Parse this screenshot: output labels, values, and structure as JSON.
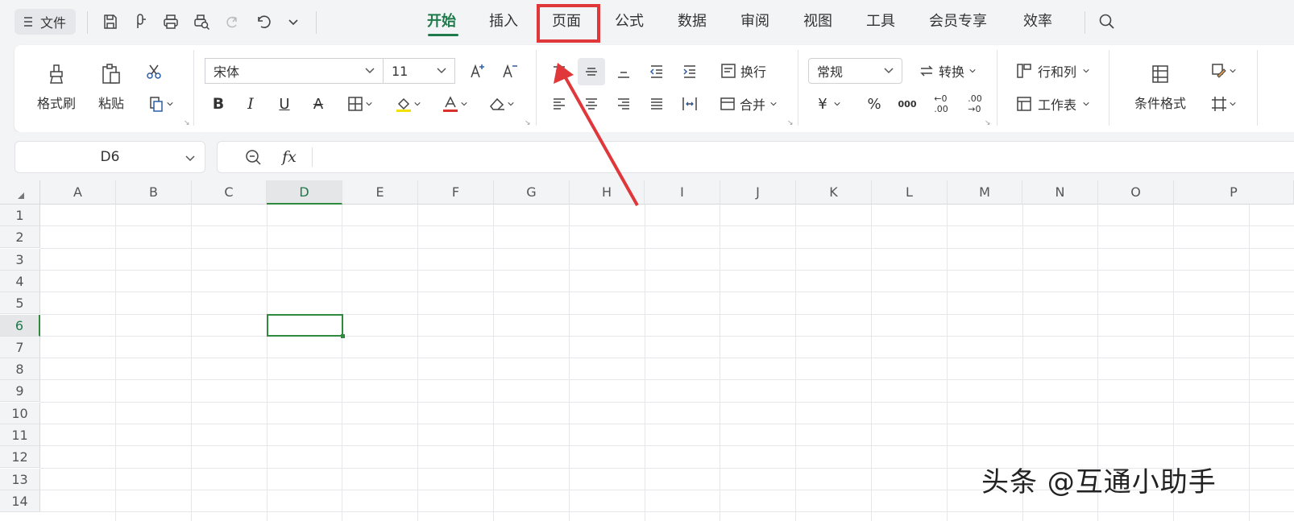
{
  "toolbar": {
    "file_label": "文件",
    "tabs": [
      "开始",
      "插入",
      "页面",
      "公式",
      "数据",
      "审阅",
      "视图",
      "工具",
      "会员专享",
      "效率"
    ],
    "active_tab": "开始",
    "highlighted_tab": "页面"
  },
  "ribbon": {
    "format_painter": "格式刷",
    "paste": "粘贴",
    "font_name": "宋体",
    "font_size": "11",
    "wrap": "换行",
    "merge": "合并",
    "number_format": "常规",
    "convert": "转换",
    "rows_cols": "行和列",
    "worksheet": "工作表",
    "conditional_format": "条件格式"
  },
  "formula_bar": {
    "cell_ref": "D6",
    "fx": "fx"
  },
  "sheet": {
    "columns": [
      "A",
      "B",
      "C",
      "D",
      "E",
      "F",
      "G",
      "H",
      "I",
      "J",
      "K",
      "L",
      "M",
      "N",
      "O",
      "P"
    ],
    "rows": [
      "1",
      "2",
      "3",
      "4",
      "5",
      "6",
      "7",
      "8",
      "9",
      "10",
      "11",
      "12",
      "13",
      "14"
    ],
    "selected_column": "D",
    "selected_row": "6"
  },
  "watermark": "头条 @互通小助手",
  "colors": {
    "accent": "#1e7a4a",
    "highlight": "#e0383a",
    "selection": "#2e8b3e"
  }
}
